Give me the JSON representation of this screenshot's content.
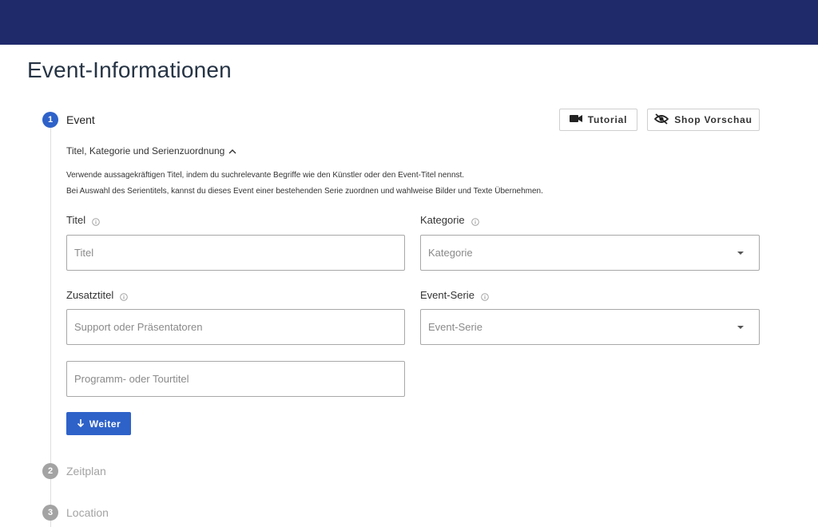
{
  "page": {
    "title": "Event-Informationen"
  },
  "steps": [
    {
      "number": "1",
      "label": "Event"
    },
    {
      "number": "2",
      "label": "Zeitplan"
    },
    {
      "number": "3",
      "label": "Location"
    }
  ],
  "toolbar": {
    "tutorial_label": "Tutorial",
    "shop_preview_label": "Shop Vorschau"
  },
  "section": {
    "toggle_label": "Titel, Kategorie und Serienzuordnung",
    "help_line1": "Verwende aussagekräftigen Titel, indem du suchrelevante Begriffe wie den Künstler oder den Event-Titel nennst.",
    "help_line2": "Bei Auswahl des Serientitels, kannst du dieses Event einer bestehenden Serie zuordnen und wahlweise Bilder und Texte Übernehmen."
  },
  "fields": {
    "titel": {
      "label": "Titel",
      "placeholder": "Titel",
      "value": ""
    },
    "kategorie": {
      "label": "Kategorie",
      "placeholder": "Kategorie"
    },
    "zusatztitel": {
      "label": "Zusatztitel",
      "placeholder": "Support oder Präsentatoren",
      "value": ""
    },
    "event_serie": {
      "label": "Event-Serie",
      "placeholder": "Event-Serie"
    },
    "programm": {
      "placeholder": "Programm- oder Tourtitel",
      "value": ""
    }
  },
  "actions": {
    "next_label": "Weiter"
  },
  "colors": {
    "header": "#1f2a6b",
    "primary": "#2e62c9",
    "inactive_step": "#a3a3a3"
  },
  "icons": {
    "tutorial": "video-camera-icon",
    "shop_preview": "eye-off-icon",
    "collapse": "chevron-up-icon",
    "info": "info-icon",
    "dropdown": "caret-down-icon",
    "next": "arrow-down-icon"
  }
}
